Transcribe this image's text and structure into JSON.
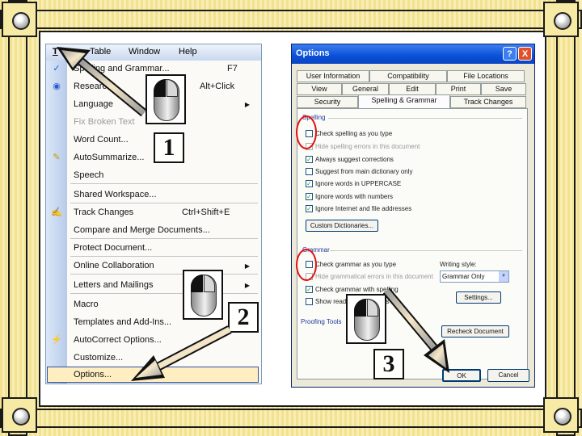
{
  "menubar": {
    "items": [
      "T",
      "Table",
      "Window",
      "Help"
    ]
  },
  "tools_menu": {
    "items": [
      {
        "label": "Spelling and Grammar...",
        "shortcut": "F7"
      },
      {
        "label": "Research...",
        "shortcut": "Alt+Click"
      },
      {
        "label": "Language"
      },
      {
        "label": "Fix Broken Text"
      },
      {
        "label": "Word Count..."
      },
      {
        "label": "AutoSummarize..."
      },
      {
        "label": "Speech"
      },
      {
        "label": "Shared Workspace..."
      },
      {
        "label": "Track Changes",
        "shortcut": "Ctrl+Shift+E"
      },
      {
        "label": "Compare and Merge Documents..."
      },
      {
        "label": "Protect Document..."
      },
      {
        "label": "Online Collaboration"
      },
      {
        "label": "Letters and Mailings"
      },
      {
        "label": "Macro"
      },
      {
        "label": "Templates and Add-Ins..."
      },
      {
        "label": "AutoCorrect Options..."
      },
      {
        "label": "Customize..."
      },
      {
        "label": "Options..."
      }
    ]
  },
  "options_dialog": {
    "title": "Options",
    "help_button": "?",
    "close_button": "X",
    "tabs_row1": [
      "User Information",
      "Compatibility",
      "File Locations"
    ],
    "tabs_row2": [
      "View",
      "General",
      "Edit",
      "Print",
      "Save"
    ],
    "tabs_row3": [
      "Security",
      "Spelling & Grammar",
      "Track Changes"
    ],
    "active_tab": "Spelling & Grammar",
    "spelling": {
      "heading": "Spelling",
      "checks": [
        {
          "label": "Check spelling as you type",
          "checked": false
        },
        {
          "label": "Hide spelling errors in this document",
          "checked": false,
          "disabled": true
        },
        {
          "label": "Always suggest corrections",
          "checked": true
        },
        {
          "label": "Suggest from main dictionary only",
          "checked": false
        },
        {
          "label": "Ignore words in UPPERCASE",
          "checked": true
        },
        {
          "label": "Ignore words with numbers",
          "checked": true
        },
        {
          "label": "Ignore Internet and file addresses",
          "checked": true
        }
      ],
      "custom_dictionaries_button": "Custom Dictionaries..."
    },
    "grammar": {
      "heading": "Grammar",
      "checks": [
        {
          "label": "Check grammar as you type",
          "checked": false
        },
        {
          "label": "Hide grammatical errors in this document",
          "checked": false,
          "disabled": true
        },
        {
          "label": "Check grammar with spelling",
          "checked": true
        },
        {
          "label": "Show readability statistics",
          "checked": false
        }
      ],
      "writing_style_label": "Writing style:",
      "writing_style_value": "Grammar Only",
      "settings_button": "Settings...",
      "recheck_button": "Recheck Document"
    },
    "proofing_tools_label": "Proofing Tools",
    "ok_button": "OK",
    "cancel_button": "Cancel"
  },
  "step_labels": [
    "1",
    "2",
    "3"
  ],
  "colors": {
    "frame": "#f5e9a8",
    "highlight_ring": "#e01010",
    "title_bar": "#0a4fd8"
  }
}
